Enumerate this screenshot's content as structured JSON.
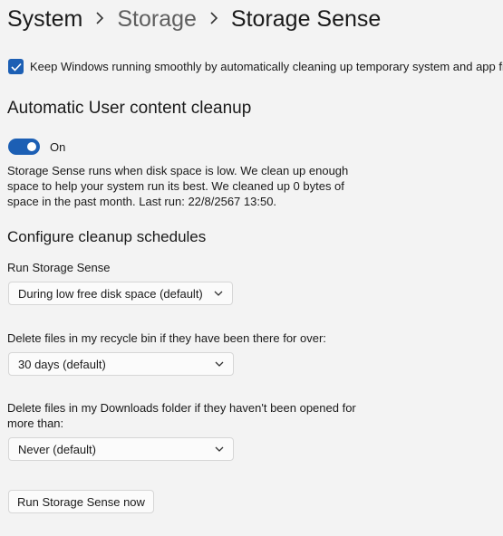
{
  "breadcrumb": {
    "root": "System",
    "middle": "Storage",
    "current": "Storage Sense"
  },
  "keep_running": {
    "label": "Keep Windows running smoothly by automatically cleaning up temporary system and app files",
    "checked": true
  },
  "auto_cleanup": {
    "heading": "Automatic User content cleanup",
    "toggle_state": "On",
    "description": "Storage Sense runs when disk space is low. We clean up enough space to help your system run its best. We cleaned up 0 bytes of space in the past month. Last run: 22/8/2567 13:50."
  },
  "schedules": {
    "heading": "Configure cleanup schedules",
    "run_label": "Run Storage Sense",
    "run_value": "During low free disk space (default)",
    "recycle_label": "Delete files in my recycle bin if they have been there for over:",
    "recycle_value": "30 days (default)",
    "downloads_label": "Delete files in my Downloads folder if they haven't been opened for more than:",
    "downloads_value": "Never (default)"
  },
  "run_now_button": "Run Storage Sense now",
  "colors": {
    "accent": "#1c5fb4",
    "background": "#f3f3f3"
  },
  "icons": {
    "separator": "chevron-right-icon",
    "dropdown": "chevron-down-icon",
    "check": "checkmark-icon"
  }
}
